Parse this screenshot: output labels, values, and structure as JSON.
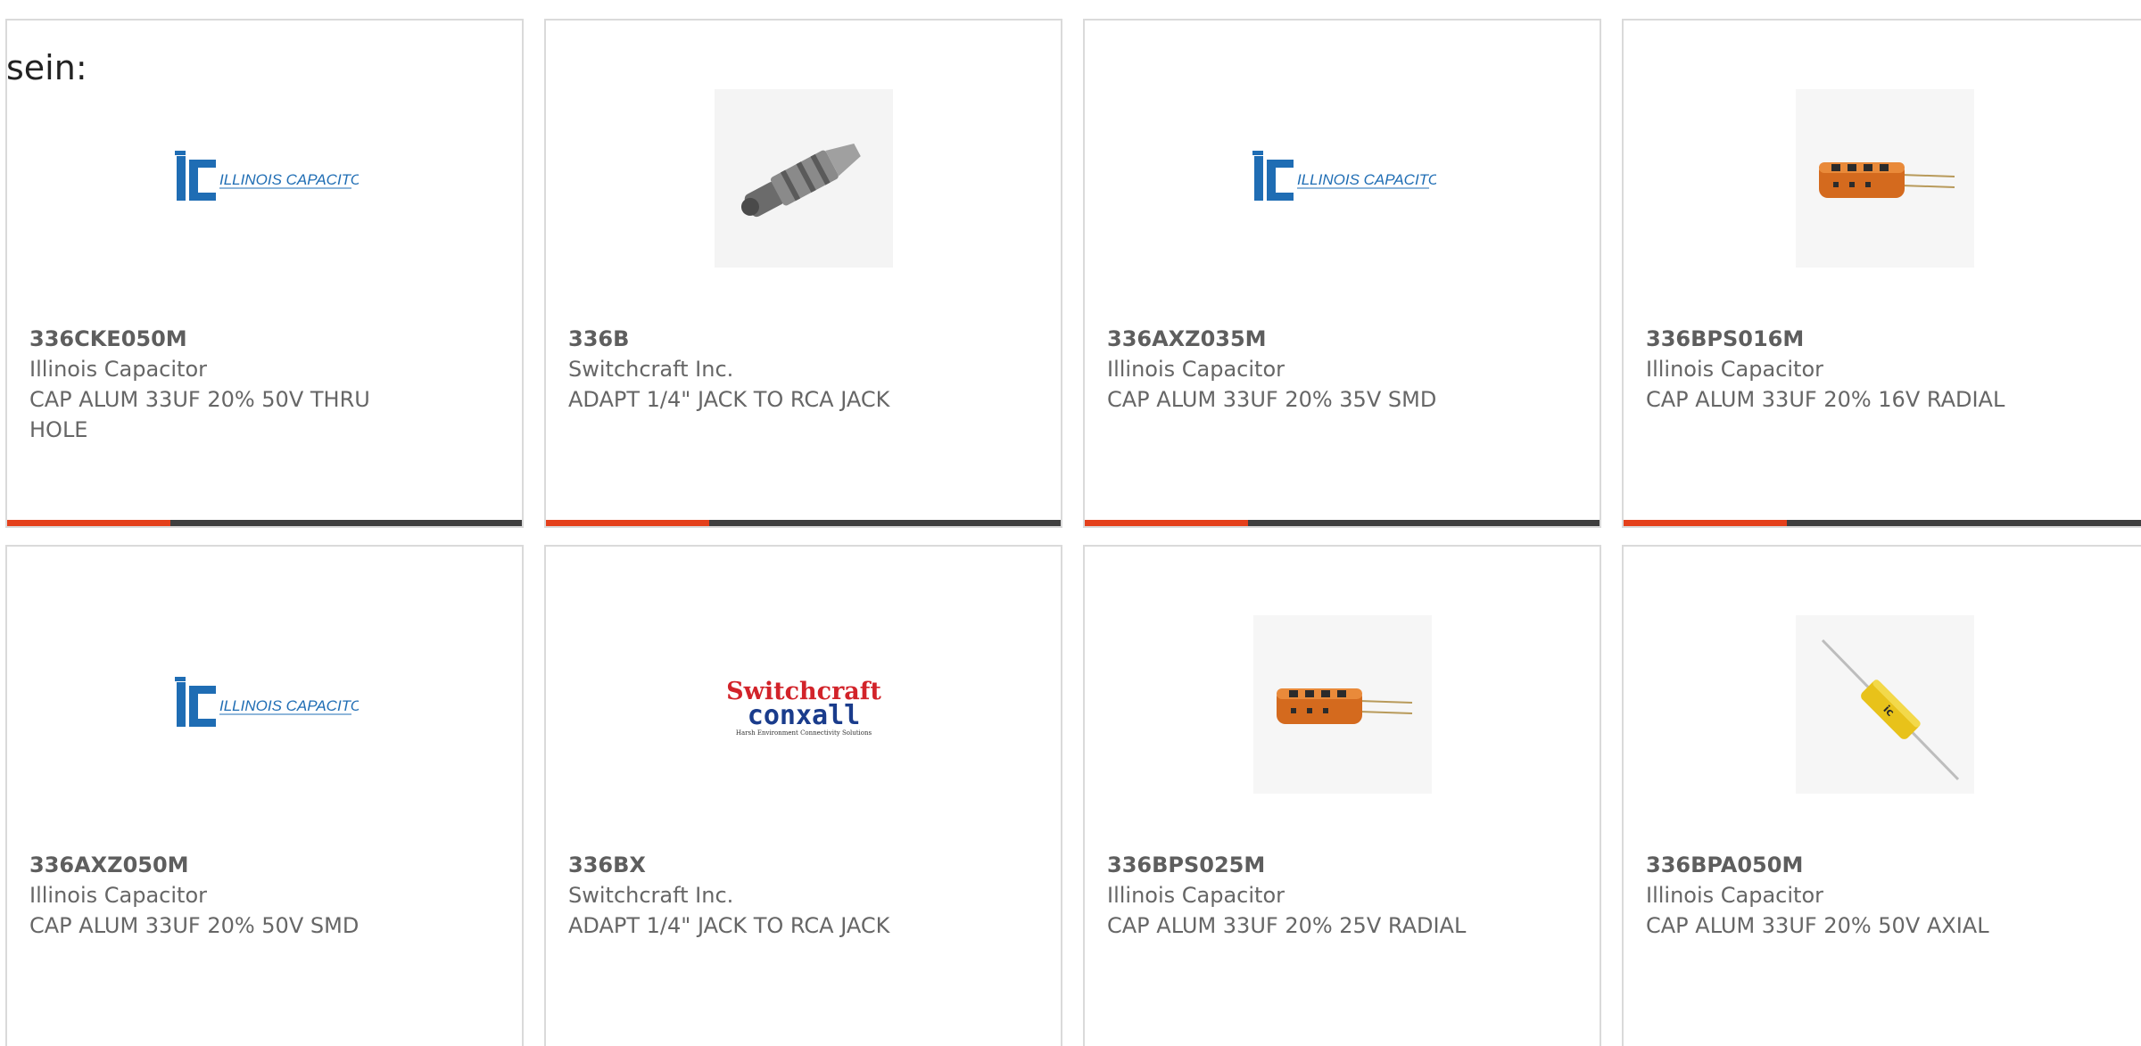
{
  "prefix": "sein:",
  "colors": {
    "accent": "#e4401b",
    "bar": "#3f3f3f",
    "border": "#dadada",
    "part_text": "#5e5e5e",
    "body_text": "#666666",
    "logo_blue": "#1f6db4",
    "switchcraft_red": "#d2232a",
    "conxall_blue": "#1a3c8c"
  },
  "products": [
    {
      "part_number": "336CKE050M",
      "manufacturer": "Illinois Capacitor",
      "description": "CAP ALUM 33UF 20% 50V THRU HOLE",
      "image": "illinois-capacitor-logo",
      "logo_text": "ILLINOIS CAPACITOR, INC."
    },
    {
      "part_number": "336B",
      "manufacturer": "Switchcraft Inc.",
      "description": "ADAPT 1/4\" JACK TO RCA JACK",
      "image": "jack-adapter-photo"
    },
    {
      "part_number": "336AXZ035M",
      "manufacturer": "Illinois Capacitor",
      "description": "CAP ALUM 33UF 20% 35V SMD",
      "image": "illinois-capacitor-logo",
      "logo_text": "ILLINOIS CAPACITOR, INC."
    },
    {
      "part_number": "336BPS016M",
      "manufacturer": "Illinois Capacitor",
      "description": "CAP ALUM 33UF 20% 16V RADIAL",
      "image": "radial-capacitor-photo"
    },
    {
      "part_number": "336AXZ050M",
      "manufacturer": "Illinois Capacitor",
      "description": "CAP ALUM 33UF 20% 50V SMD",
      "image": "illinois-capacitor-logo",
      "logo_text": "ILLINOIS CAPACITOR, INC."
    },
    {
      "part_number": "336BX",
      "manufacturer": "Switchcraft Inc.",
      "description": "ADAPT 1/4\" JACK TO RCA JACK",
      "image": "switchcraft-conxall-logo",
      "logo_text": "Switchcraft",
      "logo_text_2": "conxall",
      "logo_tagline": "Harsh Environment Connectivity Solutions"
    },
    {
      "part_number": "336BPS025M",
      "manufacturer": "Illinois Capacitor",
      "description": "CAP ALUM 33UF 20% 25V RADIAL",
      "image": "radial-capacitor-photo"
    },
    {
      "part_number": "336BPA050M",
      "manufacturer": "Illinois Capacitor",
      "description": "CAP ALUM 33UF 20% 50V AXIAL",
      "image": "axial-capacitor-photo"
    }
  ]
}
